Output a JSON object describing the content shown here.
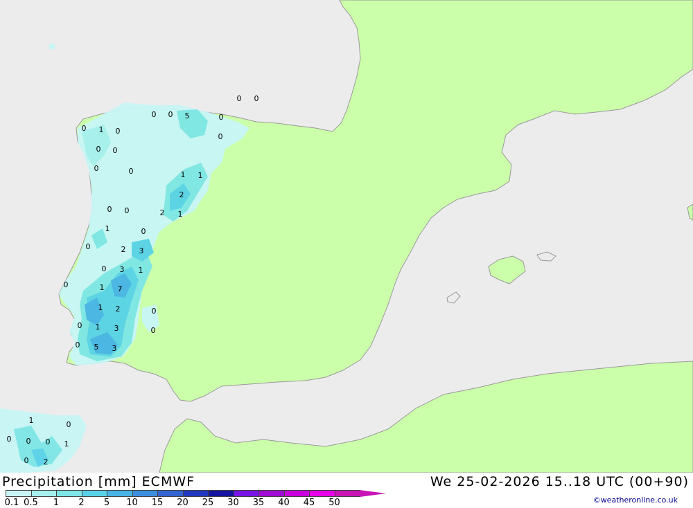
{
  "title": {
    "left": "Precipitation [mm] ECMWF",
    "right": "We 25-02-2026 15..18 UTC (00+90)"
  },
  "credit": "©weatheronline.co.uk",
  "colors": {
    "sea": "#ececec",
    "land": "#ccffaa",
    "coast": "#999999"
  },
  "legend": {
    "ticks": [
      "0.1",
      "0.5",
      "1",
      "2",
      "5",
      "10",
      "15",
      "20",
      "25",
      "30",
      "35",
      "40",
      "45",
      "50"
    ],
    "colors": [
      "#c8f6f6",
      "#a6f0f0",
      "#7de6e6",
      "#58d2e8",
      "#46b4e6",
      "#3c8fe0",
      "#3264d2",
      "#2038c0",
      "#1414a0",
      "#7814e6",
      "#a00ad2",
      "#c800dc",
      "#e600e6",
      "#c814b4"
    ]
  },
  "point_values": [
    {
      "id": "p1",
      "text": "0"
    },
    {
      "id": "p2",
      "text": "0"
    },
    {
      "id": "p3",
      "text": "0"
    },
    {
      "id": "p4",
      "text": "0"
    },
    {
      "id": "p5",
      "text": "5"
    },
    {
      "id": "p6",
      "text": "0"
    },
    {
      "id": "p7",
      "text": "0"
    },
    {
      "id": "p8",
      "text": "1"
    },
    {
      "id": "p9",
      "text": "0"
    },
    {
      "id": "p10",
      "text": "0"
    },
    {
      "id": "p11",
      "text": "0"
    },
    {
      "id": "p12",
      "text": "0"
    },
    {
      "id": "p13",
      "text": "0"
    },
    {
      "id": "p14",
      "text": "0"
    },
    {
      "id": "p15",
      "text": "1"
    },
    {
      "id": "p16",
      "text": "1"
    },
    {
      "id": "p17",
      "text": "2"
    },
    {
      "id": "p18",
      "text": "0"
    },
    {
      "id": "p19",
      "text": "0"
    },
    {
      "id": "p20",
      "text": "2"
    },
    {
      "id": "p21",
      "text": "1"
    },
    {
      "id": "p22",
      "text": "1"
    },
    {
      "id": "p23",
      "text": "0"
    },
    {
      "id": "p24",
      "text": "0"
    },
    {
      "id": "p25",
      "text": "2"
    },
    {
      "id": "p26",
      "text": "3"
    },
    {
      "id": "p27",
      "text": "0"
    },
    {
      "id": "p28",
      "text": "3"
    },
    {
      "id": "p29",
      "text": "1"
    },
    {
      "id": "p30",
      "text": "0"
    },
    {
      "id": "p31",
      "text": "1"
    },
    {
      "id": "p32",
      "text": "7"
    },
    {
      "id": "p33",
      "text": "1"
    },
    {
      "id": "p34",
      "text": "2"
    },
    {
      "id": "p35",
      "text": "0"
    },
    {
      "id": "p36",
      "text": "0"
    },
    {
      "id": "p37",
      "text": "1"
    },
    {
      "id": "p38",
      "text": "3"
    },
    {
      "id": "p39",
      "text": "0"
    },
    {
      "id": "p40",
      "text": "0"
    },
    {
      "id": "p41",
      "text": "5"
    },
    {
      "id": "p42",
      "text": "3"
    },
    {
      "id": "p43",
      "text": "1"
    },
    {
      "id": "p44",
      "text": "0"
    },
    {
      "id": "p45",
      "text": "0"
    },
    {
      "id": "p46",
      "text": "0"
    },
    {
      "id": "p47",
      "text": "0"
    },
    {
      "id": "p48",
      "text": "1"
    },
    {
      "id": "p49",
      "text": "0"
    },
    {
      "id": "p50",
      "text": "2"
    }
  ]
}
